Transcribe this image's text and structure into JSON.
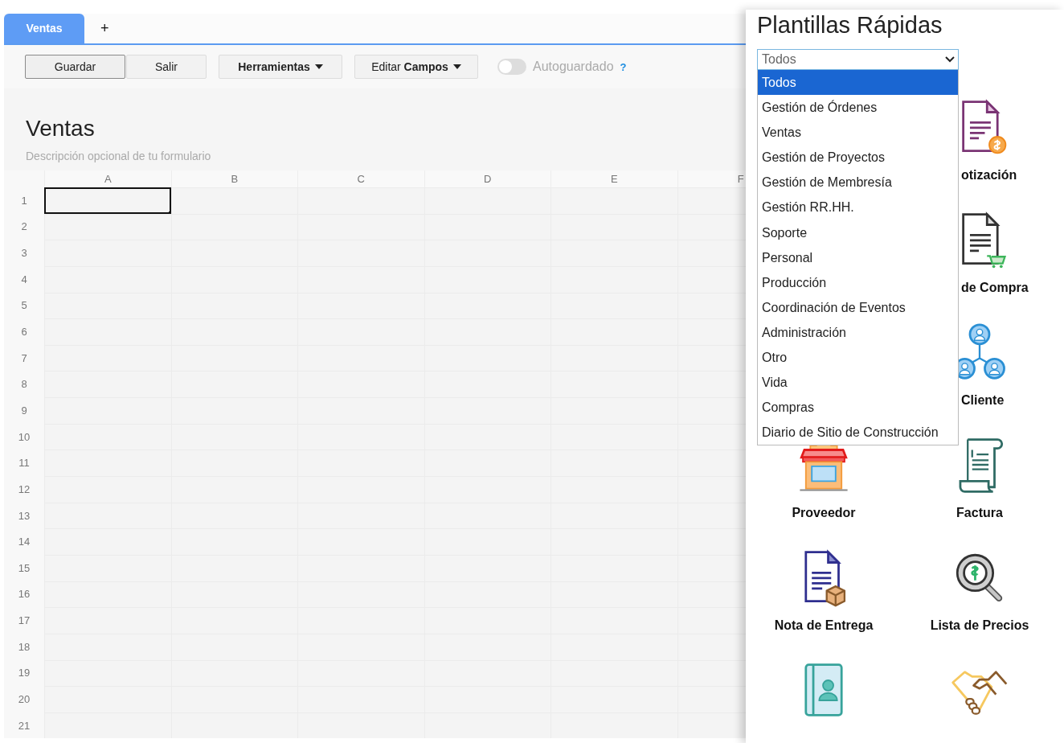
{
  "tabs": [
    {
      "label": "Ventas",
      "selected": true
    },
    {
      "label": "+",
      "selected": false
    }
  ],
  "toolbar": {
    "buttons": [
      {
        "label": "Guardar",
        "kind": "primary"
      },
      {
        "label": "Salir",
        "kind": "plain"
      },
      {
        "label": "**Herramientas**",
        "kind": "menu"
      },
      {
        "label": "Editar **Campos**",
        "kind": "menu"
      }
    ],
    "autosave": {
      "label": "Autoguardado",
      "on": false,
      "help": "?"
    }
  },
  "form": {
    "title": "Ventas",
    "description": "Descripción opcional de tu formulario"
  },
  "sheet": {
    "columns": [
      "A",
      "B",
      "C",
      "D",
      "E",
      "F"
    ],
    "rows": [
      {
        "label": "1",
        "cells": [
          {
            "selected": true
          },
          {
            "selected": false
          },
          {
            "selected": false
          },
          {
            "selected": false
          },
          {
            "selected": false
          },
          {
            "selected": false
          }
        ]
      },
      {
        "label": "2",
        "cells": [
          {
            "selected": false
          },
          {
            "selected": false
          },
          {
            "selected": false
          },
          {
            "selected": false
          },
          {
            "selected": false
          },
          {
            "selected": false
          }
        ]
      },
      {
        "label": "3",
        "cells": [
          {
            "selected": false
          },
          {
            "selected": false
          },
          {
            "selected": false
          },
          {
            "selected": false
          },
          {
            "selected": false
          },
          {
            "selected": false
          }
        ]
      },
      {
        "label": "4",
        "cells": [
          {
            "selected": false
          },
          {
            "selected": false
          },
          {
            "selected": false
          },
          {
            "selected": false
          },
          {
            "selected": false
          },
          {
            "selected": false
          }
        ]
      },
      {
        "label": "5",
        "cells": [
          {
            "selected": false
          },
          {
            "selected": false
          },
          {
            "selected": false
          },
          {
            "selected": false
          },
          {
            "selected": false
          },
          {
            "selected": false
          }
        ]
      },
      {
        "label": "6",
        "cells": [
          {
            "selected": false
          },
          {
            "selected": false
          },
          {
            "selected": false
          },
          {
            "selected": false
          },
          {
            "selected": false
          },
          {
            "selected": false
          }
        ]
      },
      {
        "label": "7",
        "cells": [
          {
            "selected": false
          },
          {
            "selected": false
          },
          {
            "selected": false
          },
          {
            "selected": false
          },
          {
            "selected": false
          },
          {
            "selected": false
          }
        ]
      },
      {
        "label": "8",
        "cells": [
          {
            "selected": false
          },
          {
            "selected": false
          },
          {
            "selected": false
          },
          {
            "selected": false
          },
          {
            "selected": false
          },
          {
            "selected": false
          }
        ]
      },
      {
        "label": "9",
        "cells": [
          {
            "selected": false
          },
          {
            "selected": false
          },
          {
            "selected": false
          },
          {
            "selected": false
          },
          {
            "selected": false
          },
          {
            "selected": false
          }
        ]
      },
      {
        "label": "10",
        "cells": [
          {
            "selected": false
          },
          {
            "selected": false
          },
          {
            "selected": false
          },
          {
            "selected": false
          },
          {
            "selected": false
          },
          {
            "selected": false
          }
        ]
      },
      {
        "label": "11",
        "cells": [
          {
            "selected": false
          },
          {
            "selected": false
          },
          {
            "selected": false
          },
          {
            "selected": false
          },
          {
            "selected": false
          },
          {
            "selected": false
          }
        ]
      },
      {
        "label": "12",
        "cells": [
          {
            "selected": false
          },
          {
            "selected": false
          },
          {
            "selected": false
          },
          {
            "selected": false
          },
          {
            "selected": false
          },
          {
            "selected": false
          }
        ]
      },
      {
        "label": "13",
        "cells": [
          {
            "selected": false
          },
          {
            "selected": false
          },
          {
            "selected": false
          },
          {
            "selected": false
          },
          {
            "selected": false
          },
          {
            "selected": false
          }
        ]
      },
      {
        "label": "14",
        "cells": [
          {
            "selected": false
          },
          {
            "selected": false
          },
          {
            "selected": false
          },
          {
            "selected": false
          },
          {
            "selected": false
          },
          {
            "selected": false
          }
        ]
      },
      {
        "label": "15",
        "cells": [
          {
            "selected": false
          },
          {
            "selected": false
          },
          {
            "selected": false
          },
          {
            "selected": false
          },
          {
            "selected": false
          },
          {
            "selected": false
          }
        ]
      },
      {
        "label": "16",
        "cells": [
          {
            "selected": false
          },
          {
            "selected": false
          },
          {
            "selected": false
          },
          {
            "selected": false
          },
          {
            "selected": false
          },
          {
            "selected": false
          }
        ]
      },
      {
        "label": "17",
        "cells": [
          {
            "selected": false
          },
          {
            "selected": false
          },
          {
            "selected": false
          },
          {
            "selected": false
          },
          {
            "selected": false
          },
          {
            "selected": false
          }
        ]
      },
      {
        "label": "18",
        "cells": [
          {
            "selected": false
          },
          {
            "selected": false
          },
          {
            "selected": false
          },
          {
            "selected": false
          },
          {
            "selected": false
          },
          {
            "selected": false
          }
        ]
      },
      {
        "label": "19",
        "cells": [
          {
            "selected": false
          },
          {
            "selected": false
          },
          {
            "selected": false
          },
          {
            "selected": false
          },
          {
            "selected": false
          },
          {
            "selected": false
          }
        ]
      },
      {
        "label": "20",
        "cells": [
          {
            "selected": false
          },
          {
            "selected": false
          },
          {
            "selected": false
          },
          {
            "selected": false
          },
          {
            "selected": false
          },
          {
            "selected": false
          }
        ]
      },
      {
        "label": "21",
        "cells": [
          {
            "selected": false
          },
          {
            "selected": false
          },
          {
            "selected": false
          },
          {
            "selected": false
          },
          {
            "selected": false
          },
          {
            "selected": false
          }
        ]
      }
    ]
  },
  "panel": {
    "title": "Plantillas Rápidas",
    "category_select": {
      "value": "Todos",
      "expanded": true,
      "options": [
        {
          "label": "Todos",
          "selected": true
        },
        {
          "label": "Gestión de Órdenes",
          "selected": false
        },
        {
          "label": "Ventas",
          "selected": false
        },
        {
          "label": "Gestión de Proyectos",
          "selected": false
        },
        {
          "label": "Gestión de Membresía",
          "selected": false
        },
        {
          "label": "Gestión RR.HH.",
          "selected": false
        },
        {
          "label": "Soporte",
          "selected": false
        },
        {
          "label": "Personal",
          "selected": false
        },
        {
          "label": "Producción",
          "selected": false
        },
        {
          "label": "Coordinación de Eventos",
          "selected": false
        },
        {
          "label": "Administración",
          "selected": false
        },
        {
          "label": "Otro",
          "selected": false
        },
        {
          "label": "Vida",
          "selected": false
        },
        {
          "label": "Compras",
          "selected": false
        },
        {
          "label": "Diario de Sitio de Construcción",
          "selected": false
        }
      ]
    },
    "covered_templates": [
      {
        "label": "otización",
        "kind": "quote"
      },
      {
        "label": "de Compra",
        "kind": "purchase"
      },
      {
        "label": "Cliente",
        "kind": "clients"
      }
    ],
    "templates": [
      {
        "label": "Proveedor",
        "kind": "store"
      },
      {
        "label": "Factura",
        "kind": "invoice"
      },
      {
        "label": "Nota de Entrega",
        "kind": "delivery"
      },
      {
        "label": "Lista de Precios",
        "kind": "price"
      },
      {
        "kind": "contacts"
      },
      {
        "kind": "handshake"
      }
    ]
  }
}
